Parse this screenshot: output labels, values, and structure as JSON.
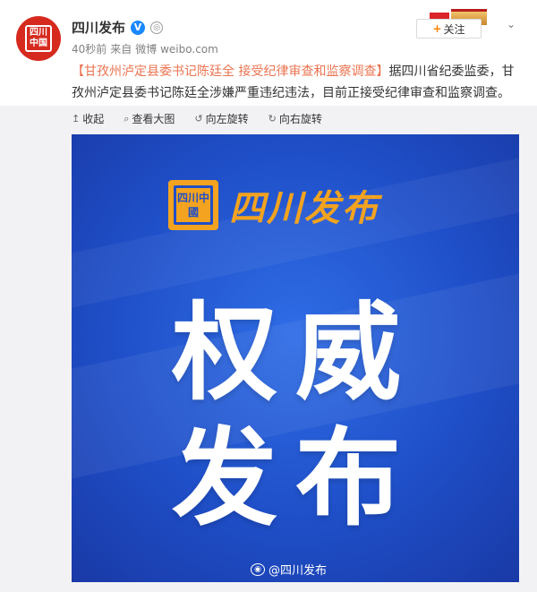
{
  "author": {
    "name": "四川发布",
    "avatar_text": "四川中国",
    "verified_icon": "verified-v-icon",
    "medal_icon": "medal-icon"
  },
  "meta": {
    "time": "40秒前",
    "source_prefix": "来自",
    "source": "微博 weibo.com"
  },
  "follow": {
    "plus": "+",
    "label": "关注"
  },
  "post": {
    "title_link": "【甘孜州泸定县委书记陈廷全 接受纪律审查和监察调查】",
    "body": "据四川省纪委监委，甘孜州泸定县委书记陈廷全涉嫌严重违纪违法，目前正接受纪律审查和监察调查。"
  },
  "toolbar": {
    "collapse": "收起",
    "view_large": "查看大图",
    "rotate_left": "向左旋转",
    "rotate_right": "向右旋转"
  },
  "image": {
    "logo_seal": "四川中國",
    "logo_text": "四川发布",
    "line1": "权威",
    "line2": "发布",
    "watermark": "@四川发布"
  },
  "colors": {
    "brand_red": "#d62a1f",
    "link_orange": "#eb7350",
    "card_blue": "#1f4fc8",
    "logo_gold": "#f3a320"
  }
}
